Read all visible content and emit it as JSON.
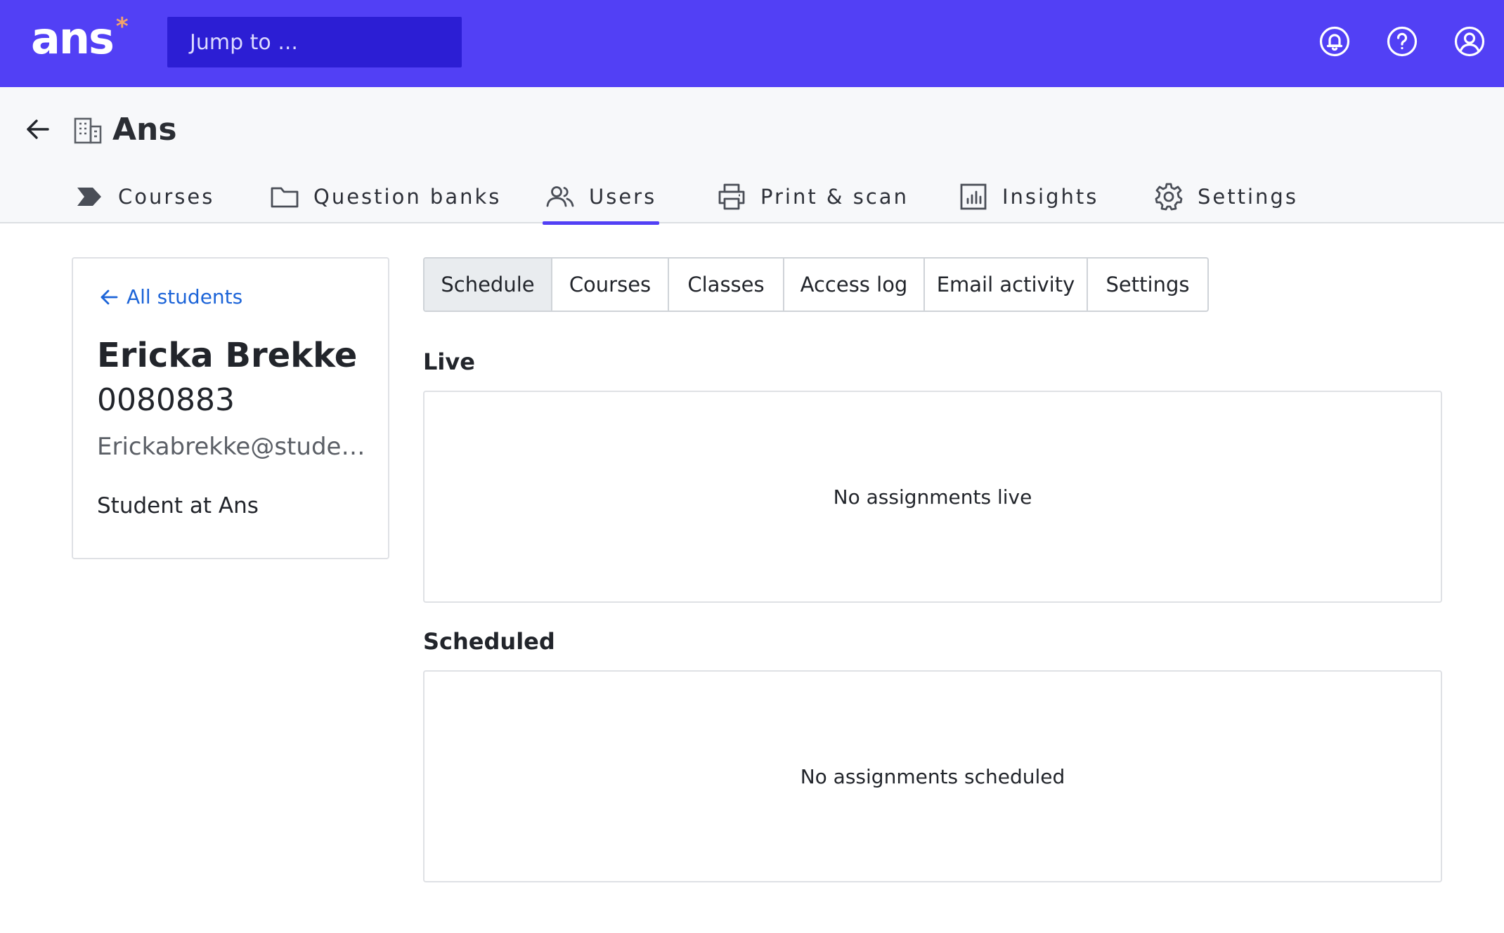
{
  "topbar": {
    "logo_text": "ans",
    "logo_star": "*",
    "search_placeholder": "Jump to ...",
    "icons": [
      "notification-bell-icon",
      "help-icon",
      "account-icon"
    ],
    "color": "#5240f5"
  },
  "header": {
    "org_title": "Ans"
  },
  "nav": {
    "items": [
      {
        "label": "Courses",
        "icon": "courses-chevron-icon"
      },
      {
        "label": "Question banks",
        "icon": "folder-icon"
      },
      {
        "label": "Users",
        "icon": "users-icon",
        "active": true
      },
      {
        "label": "Print & scan",
        "icon": "printer-icon"
      },
      {
        "label": "Insights",
        "icon": "insights-chart-icon"
      },
      {
        "label": "Settings",
        "icon": "gear-icon"
      }
    ]
  },
  "student": {
    "back_link": "All students",
    "name": "Ericka Brekke",
    "number": "0080883",
    "email": "Erickabrekke@studen...",
    "role": "Student at Ans"
  },
  "tabs": [
    {
      "label": "Schedule",
      "active": true
    },
    {
      "label": "Courses"
    },
    {
      "label": "Classes"
    },
    {
      "label": "Access log"
    },
    {
      "label": "Email activity"
    },
    {
      "label": "Settings"
    }
  ],
  "sections": {
    "live": {
      "title": "Live",
      "empty_text": "No assignments live"
    },
    "scheduled": {
      "title": "Scheduled",
      "empty_text": "No assignments scheduled"
    }
  }
}
